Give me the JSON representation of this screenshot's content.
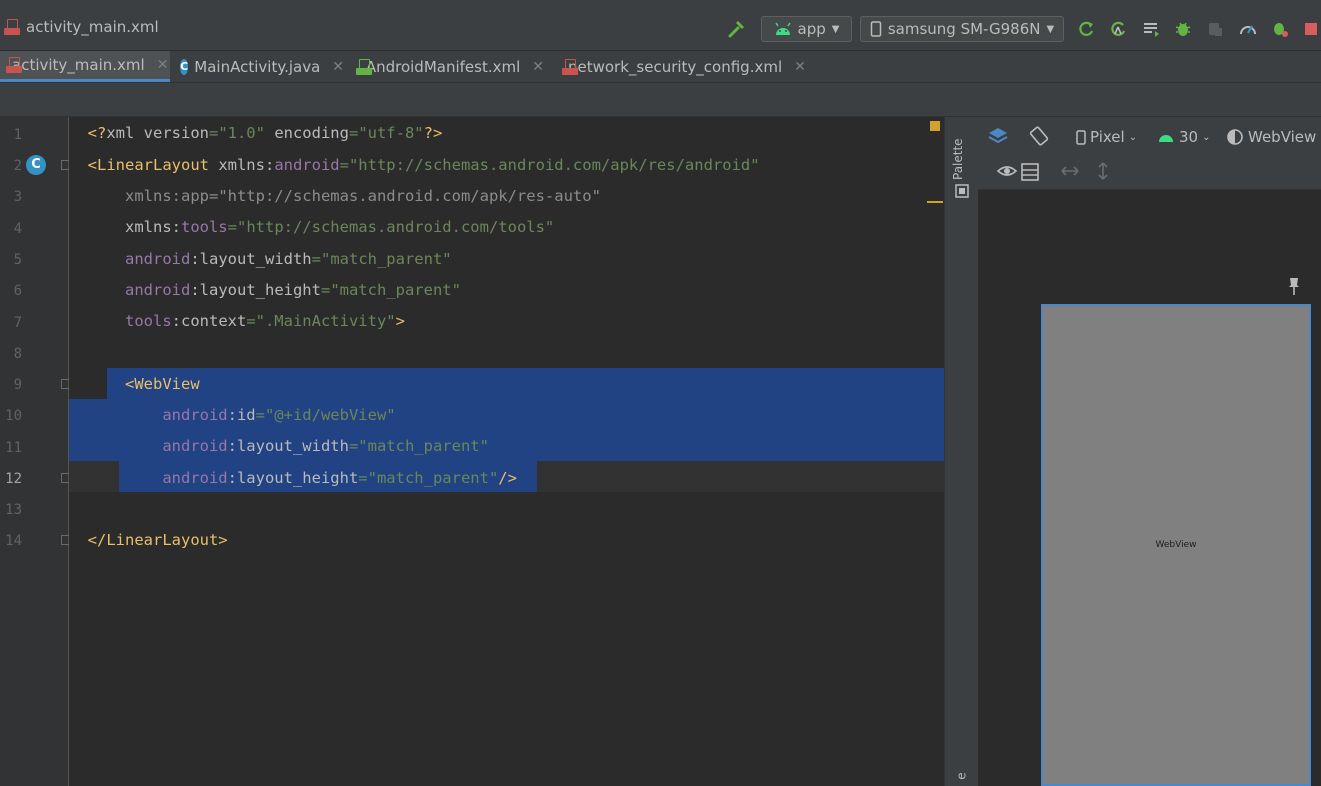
{
  "window": {
    "breadcrumb_file": "activity_main.xml"
  },
  "toolbar": {
    "run_config": "app",
    "device": "samsung SM-G986N",
    "colors": {
      "run_green": "#3fa65a",
      "stop_red": "#db5c5c",
      "android_green": "#3ddc84"
    }
  },
  "tabs": [
    {
      "label": "activity_main.xml",
      "icon": "xml-file-icon",
      "active": true
    },
    {
      "label": "MainActivity.java",
      "icon": "java-class-icon",
      "active": false
    },
    {
      "label": "AndroidManifest.xml",
      "icon": "manifest-icon",
      "active": false
    },
    {
      "label": "network_security_config.xml",
      "icon": "xml-file-icon",
      "active": false
    }
  ],
  "editor": {
    "line_numbers": [
      "1",
      "2",
      "3",
      "4",
      "5",
      "6",
      "7",
      "8",
      "9",
      "10",
      "11",
      "12",
      "13",
      "14"
    ],
    "current_line": "12"
  },
  "design_panel": {
    "palette_label": "Palette",
    "device_chip": "Pixel",
    "api_chip": "30",
    "theme_chip": "WebView",
    "preview_label": "WebView",
    "side_letter": "e"
  }
}
